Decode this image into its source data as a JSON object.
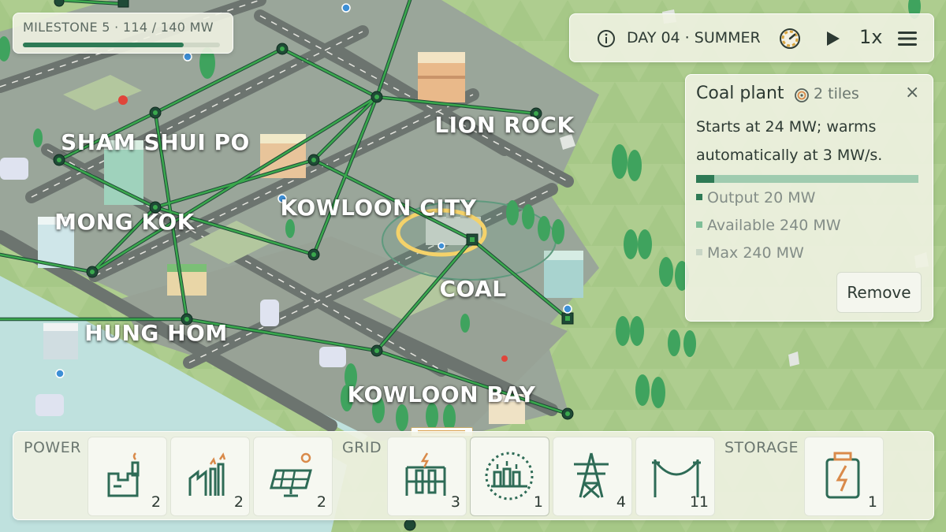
{
  "milestone": {
    "label": "MILESTONE 5 · 114 / 140 MW",
    "progress": 0.814
  },
  "topbar": {
    "day": "DAY 04 · SUMMER",
    "speed": "1x",
    "icons": [
      "info-icon",
      "clock-icon",
      "play-icon",
      "menu-icon"
    ]
  },
  "districts": [
    "SHAM SHUI PO",
    "LION ROCK",
    "MONG KOK",
    "KOWLOON CITY",
    "COAL",
    "HUNG HOM",
    "KOWLOON BAY"
  ],
  "info": {
    "title": "Coal plant",
    "tiles": "2 tiles",
    "close": "×",
    "description": "Starts at 24 MW; warms automatically at 3 MW/s.",
    "output_fraction": 0.083,
    "stats": [
      {
        "label": "Output 20 MW",
        "color": "#2e7a55"
      },
      {
        "label": "Available 240 MW",
        "color": "#7fbf98"
      },
      {
        "label": "Max 240 MW",
        "color": "#c9d6c6"
      }
    ],
    "remove_label": "Remove"
  },
  "toolbar": {
    "groups": {
      "power": "POWER",
      "grid": "GRID",
      "storage": "STORAGE"
    },
    "tools": [
      {
        "name": "coal-plant",
        "count": "2"
      },
      {
        "name": "gas-plant",
        "count": "2"
      },
      {
        "name": "solar-panel",
        "count": "2"
      },
      {
        "name": "substation",
        "count": "3"
      },
      {
        "name": "transformer",
        "count": "1"
      },
      {
        "name": "pylon",
        "count": "4"
      },
      {
        "name": "power-line",
        "count": "11"
      },
      {
        "name": "battery",
        "count": "1"
      }
    ]
  },
  "colors": {
    "accent": "#2e7a55",
    "line": "#3aa84d",
    "panel": "#eff2e2",
    "icon": "#2e6b56",
    "icon_accent": "#d98a4a"
  }
}
